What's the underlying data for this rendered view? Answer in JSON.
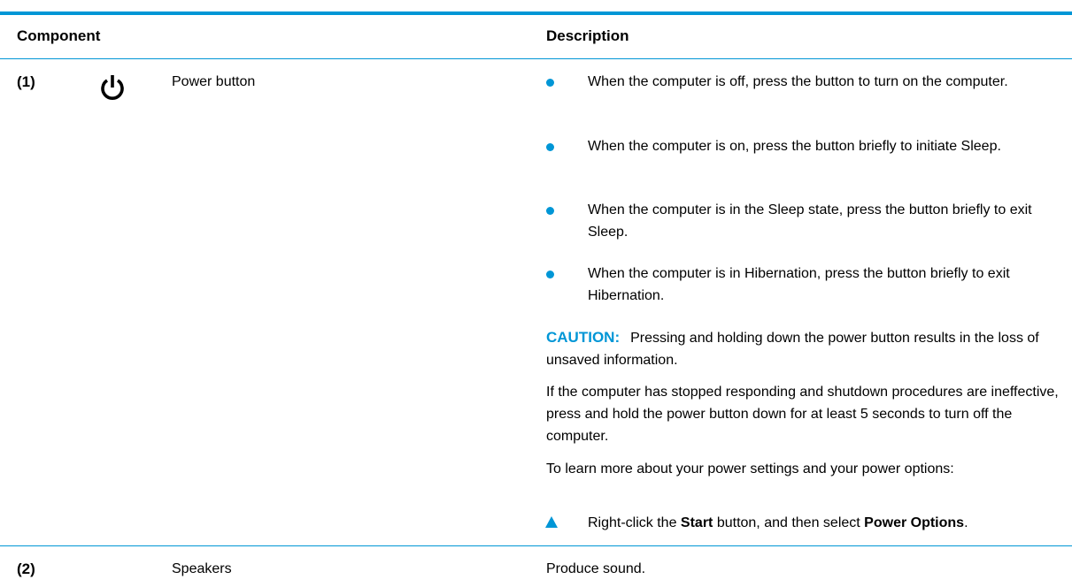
{
  "table": {
    "headers": {
      "component": "Component",
      "description": "Description"
    },
    "rows": [
      {
        "number": "(1)",
        "icon": "power-icon",
        "name": "Power button",
        "bullets": [
          "When the computer is off, press the button to turn on the computer.",
          "When the computer is on, press the button briefly to initiate Sleep.",
          "When the computer is in the Sleep state, press the button briefly to exit Sleep.",
          "When the computer is in Hibernation, press the button briefly to exit Hibernation."
        ],
        "caution": {
          "label": "CAUTION:",
          "text": "Pressing and holding down the power button results in the loss of unsaved information."
        },
        "note": "If the computer has stopped responding and shutdown procedures are ineffective, press and hold the power button down for at least 5 seconds to turn off the computer.",
        "learn_more": "To learn more about your power settings and your power options:",
        "step": {
          "part1": "Right-click the ",
          "start": "Start",
          "part2": " button, and then select ",
          "power_options": "Power Options",
          "part3": "."
        }
      },
      {
        "number": "(2)",
        "name": "Speakers",
        "description": "Produce sound."
      }
    ]
  },
  "colors": {
    "accent": "#0096d6"
  }
}
